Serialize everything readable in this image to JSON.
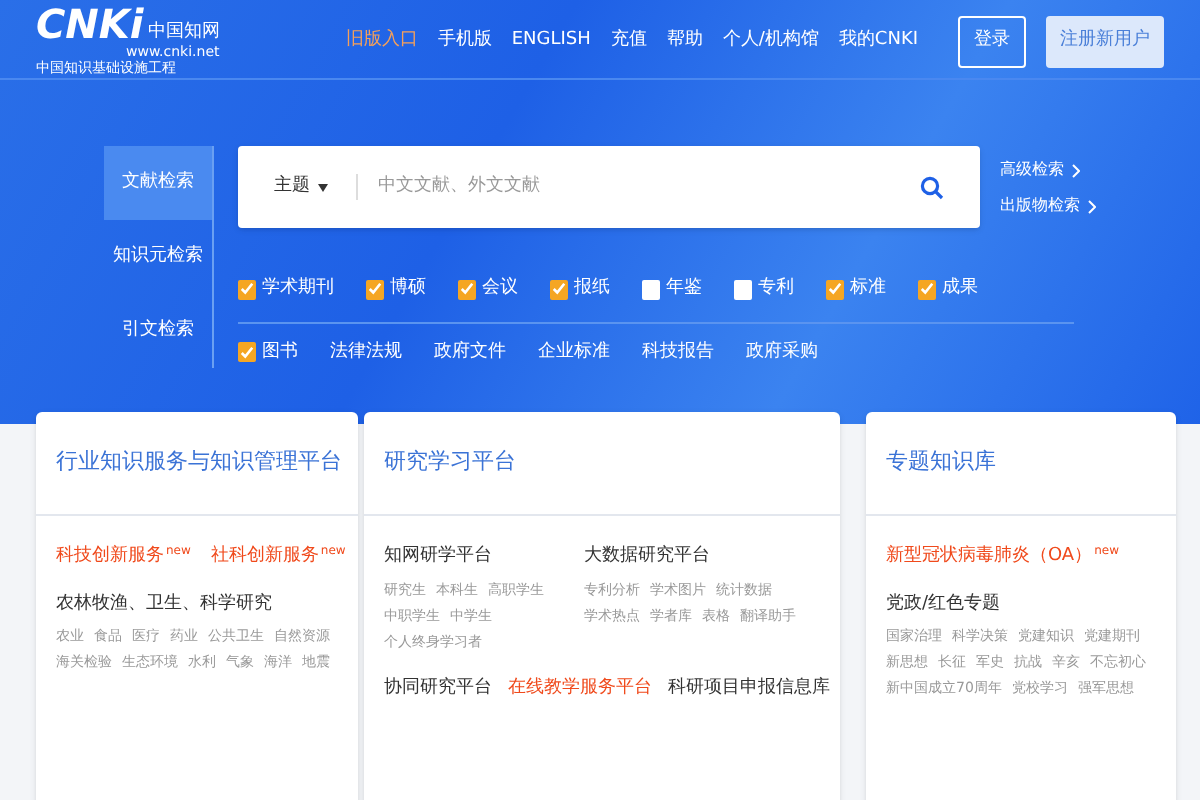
{
  "logo": {
    "mark": "CNKi",
    "name": "中国知网",
    "url": "www.cnki.net",
    "tagline": "中国知识基础设施工程"
  },
  "nav": [
    {
      "label": "旧版入口",
      "highlighted": true
    },
    {
      "label": "手机版",
      "highlighted": false
    },
    {
      "label": "ENGLISH",
      "highlighted": false
    },
    {
      "label": "充值",
      "highlighted": false
    },
    {
      "label": "帮助",
      "highlighted": false
    },
    {
      "label": "个人/机构馆",
      "highlighted": false
    },
    {
      "label": "我的CNKI",
      "highlighted": false
    }
  ],
  "account": {
    "login": "登录",
    "register": "注册新用户"
  },
  "search_tabs": [
    {
      "label": "文献检索",
      "selected": true
    },
    {
      "label": "知识元检索",
      "selected": false
    },
    {
      "label": "引文检索",
      "selected": false
    }
  ],
  "search": {
    "field": "主题",
    "placeholder": "中文文献、外文文献"
  },
  "search_links": [
    "高级检索",
    "出版物检索"
  ],
  "sources_row_1": [
    {
      "kind": "checkbox",
      "label": "学术期刊",
      "checked": true
    },
    {
      "kind": "checkbox",
      "label": "博硕",
      "checked": true
    },
    {
      "kind": "checkbox",
      "label": "会议",
      "checked": true
    },
    {
      "kind": "checkbox",
      "label": "报纸",
      "checked": true
    },
    {
      "kind": "checkbox",
      "label": "年鉴",
      "checked": false
    },
    {
      "kind": "checkbox",
      "label": "专利",
      "checked": false
    },
    {
      "kind": "checkbox",
      "label": "标准",
      "checked": true
    },
    {
      "kind": "checkbox",
      "label": "成果",
      "checked": true
    }
  ],
  "sources_row_2": [
    {
      "kind": "checkbox",
      "label": "图书",
      "checked": true
    },
    {
      "kind": "link",
      "label": "法律法规"
    },
    {
      "kind": "link",
      "label": "政府文件"
    },
    {
      "kind": "link",
      "label": "企业标准"
    },
    {
      "kind": "link",
      "label": "科技报告"
    },
    {
      "kind": "link",
      "label": "政府采购"
    }
  ],
  "cards": [
    {
      "title": "行业知识服务与知识管理平台",
      "blocks": [
        {
          "kind": "featured",
          "items": [
            {
              "label": "科技创新服务",
              "badge": "new"
            },
            {
              "label": "社科创新服务",
              "badge": "new"
            }
          ]
        },
        {
          "kind": "group",
          "heading": "农林牧渔、卫生、科学研究",
          "tags": [
            "农业",
            "食品",
            "医疗",
            "药业",
            "公共卫生",
            "自然资源",
            "海关检验",
            "生态环境",
            "水利",
            "气象",
            "海洋",
            "地震"
          ]
        }
      ]
    },
    {
      "title": "研究学习平台",
      "blocks": [
        {
          "kind": "columns",
          "groups": [
            {
              "heading": "知网研学平台",
              "tags": [
                "研究生",
                "本科生",
                "高职学生",
                "中职学生",
                "中学生",
                "个人终身学习者"
              ]
            },
            {
              "heading": "大数据研究平台",
              "tags": [
                "专利分析",
                "学术图片",
                "统计数据",
                "学术热点",
                "学者库",
                "表格",
                "翻译助手"
              ]
            }
          ]
        },
        {
          "kind": "links",
          "items": [
            {
              "label": "协同研究平台",
              "highlighted": false
            },
            {
              "label": "在线教学服务平台",
              "highlighted": true
            },
            {
              "label": "科研项目申报信息库",
              "highlighted": false
            }
          ]
        }
      ]
    },
    {
      "title": "专题知识库",
      "blocks": [
        {
          "kind": "featured",
          "items": [
            {
              "label": "新型冠状病毒肺炎（OA）",
              "badge": "new"
            }
          ]
        },
        {
          "kind": "group",
          "heading": "党政/红色专题",
          "tags": [
            "国家治理",
            "科学决策",
            "党建知识",
            "党建期刊",
            "新思想",
            "长征",
            "军史",
            "抗战",
            "辛亥",
            "不忘初心",
            "新中国成立70周年",
            "党校学习",
            "强军思想"
          ]
        }
      ]
    }
  ]
}
